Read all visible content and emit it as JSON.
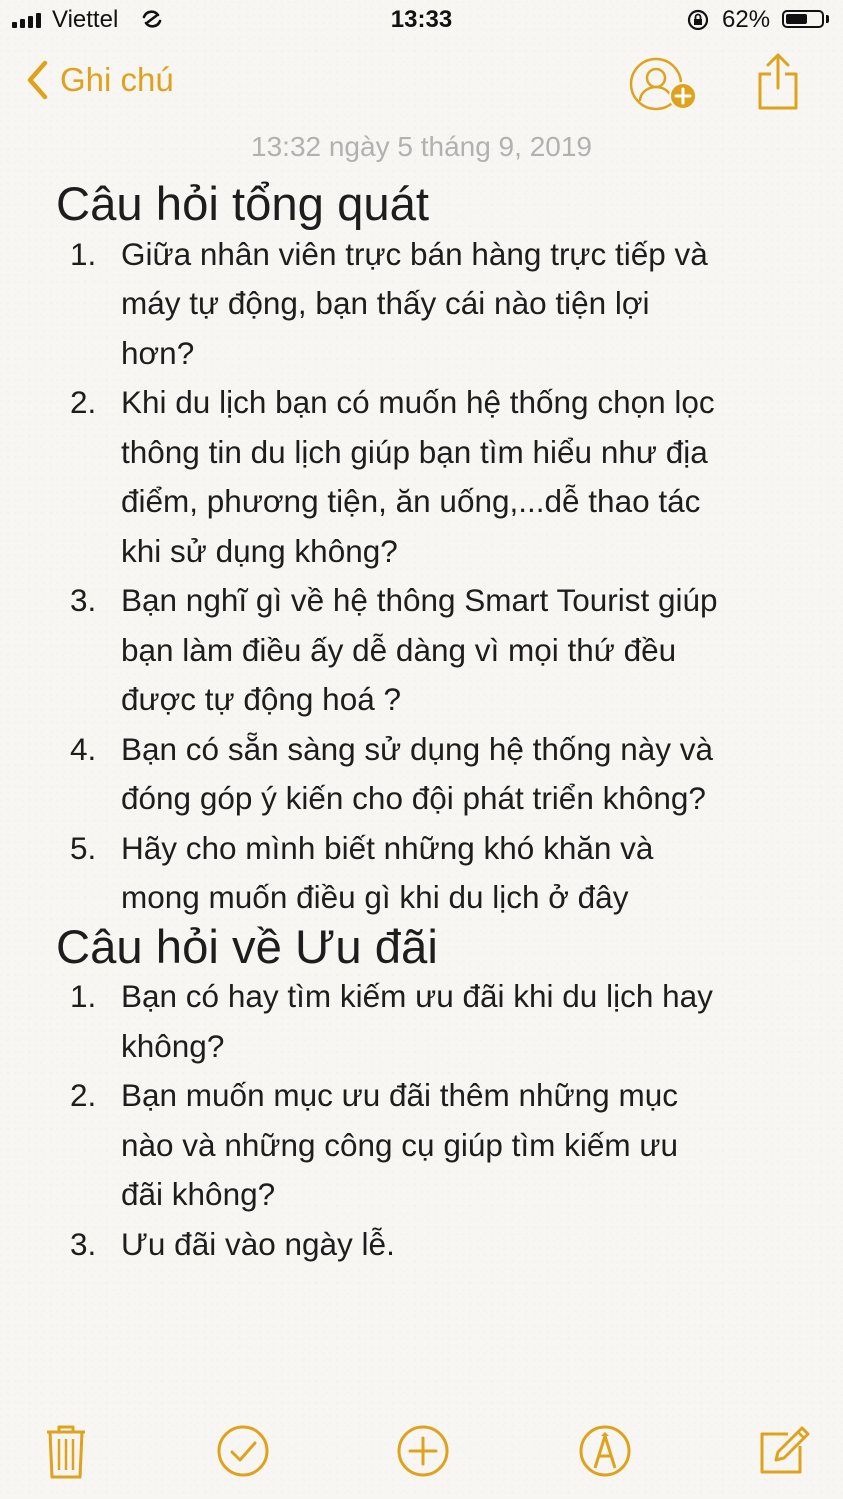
{
  "status_bar": {
    "carrier": "Viettel",
    "time": "13:33",
    "battery_percent": "62%",
    "battery_level": 0.62
  },
  "nav": {
    "back_label": "Ghi chú",
    "accent_color": "#dfa21c"
  },
  "note": {
    "timestamp": "13:32 ngày 5 tháng 9, 2019",
    "sections": [
      {
        "heading": "Câu hỏi tổng quát",
        "items": [
          {
            "number": "1.",
            "lines": [
              "Giữa nhân viên trực bán hàng trực tiếp và",
              "máy tự động, bạn thấy cái nào tiện lợi",
              "hơn?"
            ]
          },
          {
            "number": "2.",
            "lines": [
              "Khi du lịch bạn có muốn hệ thống chọn lọc",
              "thông tin du lịch giúp bạn tìm hiểu như địa",
              "điểm, phương tiện, ăn uống,...dễ thao tác",
              "khi sử dụng không?"
            ]
          },
          {
            "number": "3.",
            "lines": [
              "Bạn nghĩ gì về hệ thông Smart Tourist giúp",
              "bạn làm điều ấy dễ dàng vì mọi thứ đều",
              "được tự động hoá ?"
            ]
          },
          {
            "number": "4.",
            "lines": [
              "Bạn có sẵn sàng sử dụng hệ thống này và",
              "đóng góp ý kiến cho đội phát triển không?"
            ]
          },
          {
            "number": "5.",
            "lines": [
              "Hãy cho mình biết những khó khăn và",
              "mong muốn điều gì khi du lịch ở đây"
            ]
          }
        ]
      },
      {
        "heading": "Câu hỏi về Ưu đãi",
        "items": [
          {
            "number": "1.",
            "lines": [
              "Bạn có hay tìm kiếm ưu đãi khi du lịch hay",
              "không?"
            ]
          },
          {
            "number": "2.",
            "lines": [
              "Bạn muốn mục ưu đãi thêm những mục",
              "nào và những công cụ giúp tìm kiếm ưu",
              "đãi không?"
            ]
          },
          {
            "number": "3.",
            "lines": [
              "Ưu đãi vào ngày lễ."
            ]
          }
        ]
      }
    ]
  },
  "toolbar": {
    "icons": [
      "trash-icon",
      "checklist-icon",
      "add-icon",
      "markup-icon",
      "compose-icon"
    ]
  }
}
